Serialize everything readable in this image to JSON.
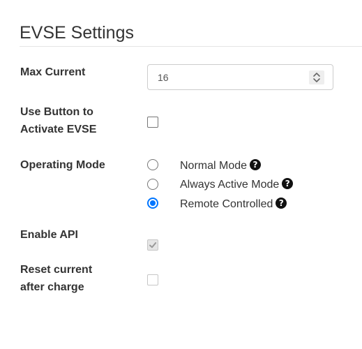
{
  "title": "EVSE Settings",
  "max_current": {
    "label": "Max Current",
    "value": "16"
  },
  "use_button": {
    "label_line1": "Use Button to",
    "label_line2": "Activate EVSE",
    "checked": false
  },
  "operating_mode": {
    "label": "Operating Mode",
    "options": [
      {
        "label": "Normal Mode",
        "selected": false
      },
      {
        "label": "Always Active Mode",
        "selected": false
      },
      {
        "label": "Remote Controlled",
        "selected": true
      }
    ],
    "help_glyph": "?"
  },
  "enable_api": {
    "label": "Enable API",
    "checked": true,
    "disabled": true
  },
  "reset_current": {
    "label_line1": "Reset current",
    "label_line2": "after charge",
    "checked": false,
    "disabled": true
  },
  "colors": {
    "accent": "#0075ff",
    "text": "#333333",
    "border": "#cccccc"
  },
  "icons": {
    "help": "question-circle-icon",
    "spinner": "up-down-chevron-icon",
    "check": "checkmark-icon"
  }
}
